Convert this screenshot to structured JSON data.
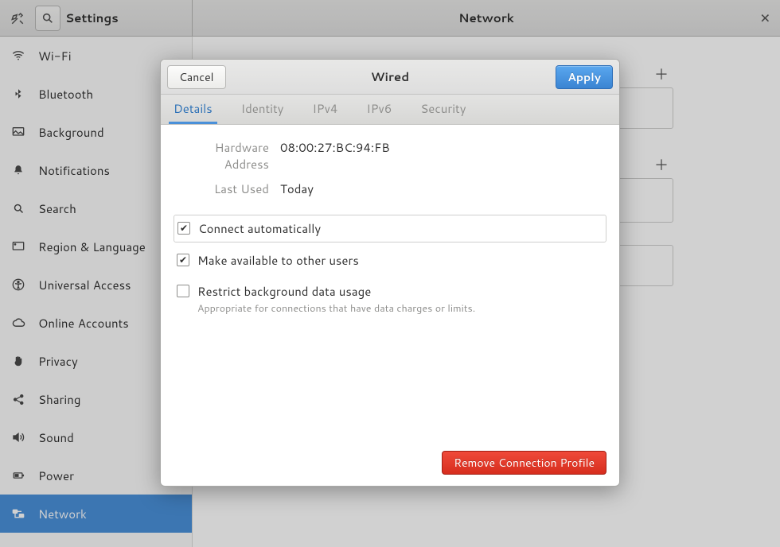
{
  "header": {
    "left_title": "Settings",
    "right_title": "Network"
  },
  "sidebar": {
    "items": [
      {
        "label": "Wi-Fi"
      },
      {
        "label": "Bluetooth"
      },
      {
        "label": "Background"
      },
      {
        "label": "Notifications"
      },
      {
        "label": "Search"
      },
      {
        "label": "Region & Language"
      },
      {
        "label": "Universal Access"
      },
      {
        "label": "Online Accounts"
      },
      {
        "label": "Privacy"
      },
      {
        "label": "Sharing"
      },
      {
        "label": "Sound"
      },
      {
        "label": "Power"
      },
      {
        "label": "Network"
      }
    ],
    "selected_index": 12
  },
  "dialog": {
    "title": "Wired",
    "cancel_label": "Cancel",
    "apply_label": "Apply",
    "tabs": [
      {
        "label": "Details"
      },
      {
        "label": "Identity"
      },
      {
        "label": "IPv4"
      },
      {
        "label": "IPv6"
      },
      {
        "label": "Security"
      }
    ],
    "active_tab_index": 0,
    "details": {
      "hardware_address_label": "Hardware Address",
      "hardware_address_value": "08:00:27:BC:94:FB",
      "last_used_label": "Last Used",
      "last_used_value": "Today",
      "connect_automatically_label": "Connect automatically",
      "connect_automatically_checked": true,
      "available_other_users_label": "Make available to other users",
      "available_other_users_checked": true,
      "restrict_bg_label": "Restrict background data usage",
      "restrict_bg_sub": "Appropriate for connections that have data charges or limits.",
      "restrict_bg_checked": false
    },
    "remove_label": "Remove Connection Profile"
  }
}
